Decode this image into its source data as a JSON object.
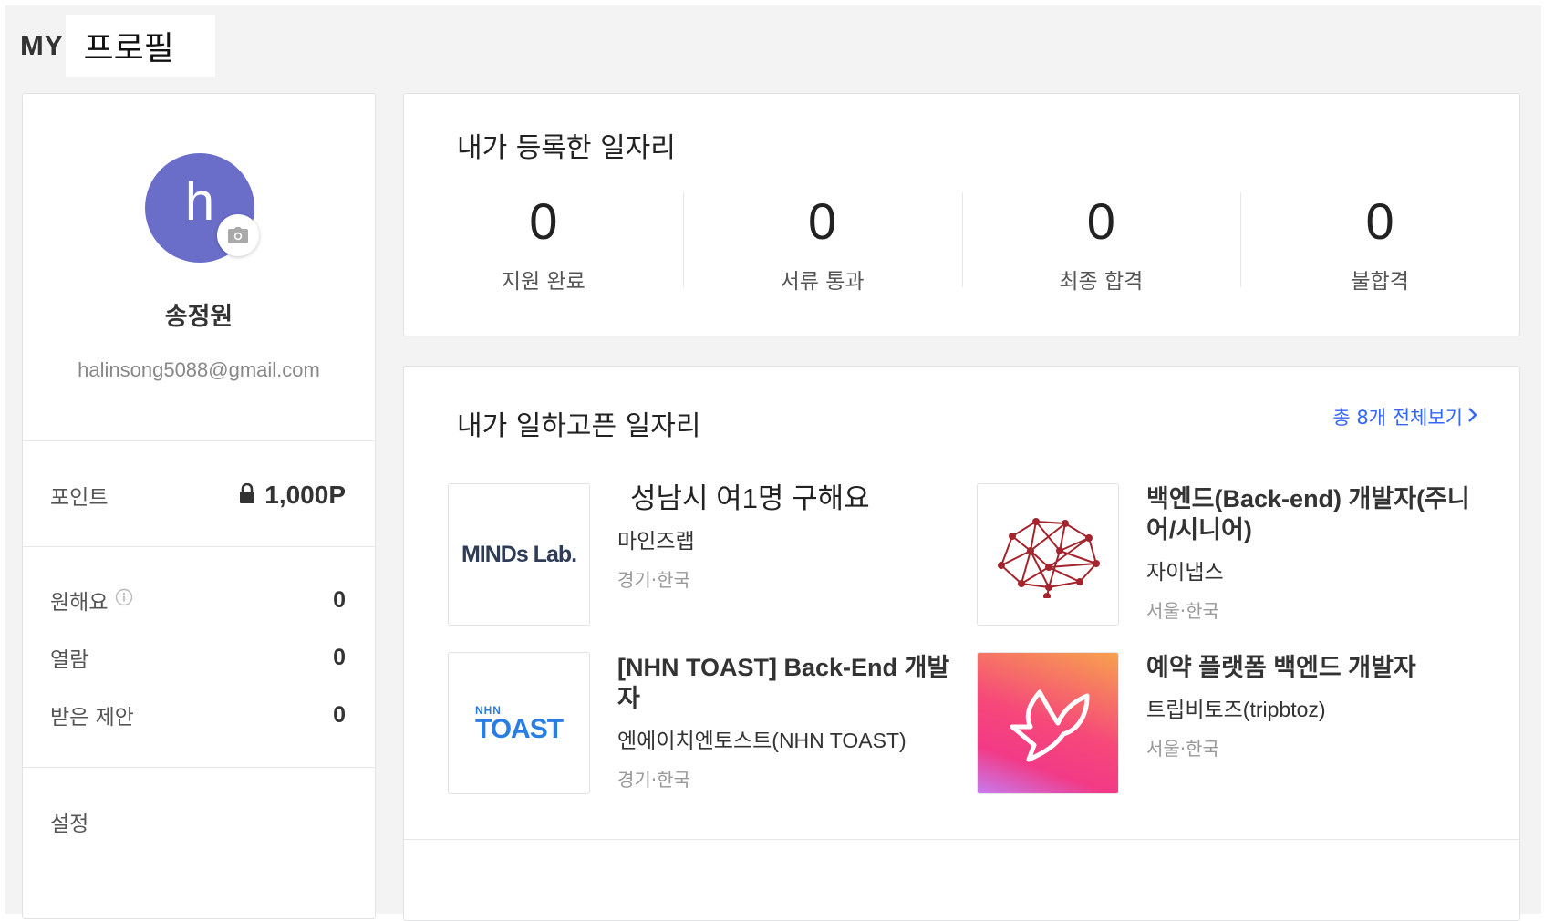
{
  "header": {
    "my_label": "MY",
    "title": "프로필"
  },
  "profile": {
    "avatar_letter": "h",
    "name": "송정원",
    "email": "halinsong5088@gmail.com",
    "points_label": "포인트",
    "points_value": "1,000P",
    "stats": [
      {
        "label": "원해요",
        "value": "0"
      },
      {
        "label": "열람",
        "value": "0"
      },
      {
        "label": "받은 제안",
        "value": "0"
      }
    ],
    "settings_label": "설정"
  },
  "registered": {
    "title": "내가 등록한 일자리",
    "stats": [
      {
        "value": "0",
        "label": "지원 완료"
      },
      {
        "value": "0",
        "label": "서류 통과"
      },
      {
        "value": "0",
        "label": "최종 합격"
      },
      {
        "value": "0",
        "label": "불합격"
      }
    ]
  },
  "wanted": {
    "title": "내가 일하고픈 일자리",
    "view_all": "총 8개 전체보기",
    "jobs": [
      {
        "title": "성남시 여1명 구해요",
        "company": "마인즈랩",
        "location": "경기·한국",
        "logo": "MINDs Lab."
      },
      {
        "title": "백엔드(Back-end) 개발자(주니어/시니어)",
        "company": "자이냅스",
        "location": "서울·한국",
        "logo": "brain-network-logo"
      },
      {
        "title": "[NHN TOAST] Back-End 개발자",
        "company": "엔에이치엔토스트(NHN TOAST)",
        "location": "경기·한국",
        "logo_small": "NHN",
        "logo": "TOAST"
      },
      {
        "title": "예약 플랫폼 백엔드 개발자",
        "company": "트립비토즈(tripbtoz)",
        "location": "서울·한국",
        "logo": "tripbtoz-fox-logo"
      }
    ]
  }
}
